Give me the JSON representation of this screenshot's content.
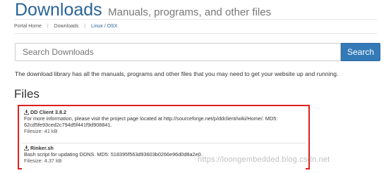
{
  "header": {
    "title": "Downloads",
    "subtitle": "Manuals, programs, and other files"
  },
  "breadcrumb": {
    "items": [
      "Portal Home",
      "Downloads",
      "Linux / OSX"
    ]
  },
  "search": {
    "placeholder": "Search Downloads",
    "button_label": "Search"
  },
  "intro": "The download library has all the manuals, programs and other files that you may need to get your website up and running.",
  "files_heading": "Files",
  "files": [
    {
      "name": "DD Client 3.8.2",
      "description_line1": "For more information, please visit the project page located at http://sourceforge.net/p/ddclient/wiki/Home/. MD5:",
      "description_line2": "62cd5fe93ced2c794d5f441f9d908841.",
      "filesize": "Filesize: 41 kB"
    },
    {
      "name": "Rinker.sh",
      "description_line1": "Bash script for updating DDNS. MD5: 518395f563d93603b0266e96d0d8a2e0.",
      "filesize": "Filesize: 4.37 kB"
    }
  ],
  "watermark": "https://loongembedded.blog.csdn.net",
  "colors": {
    "link": "#2a6496",
    "button": "#337ab7",
    "highlight_border": "#e02020"
  }
}
